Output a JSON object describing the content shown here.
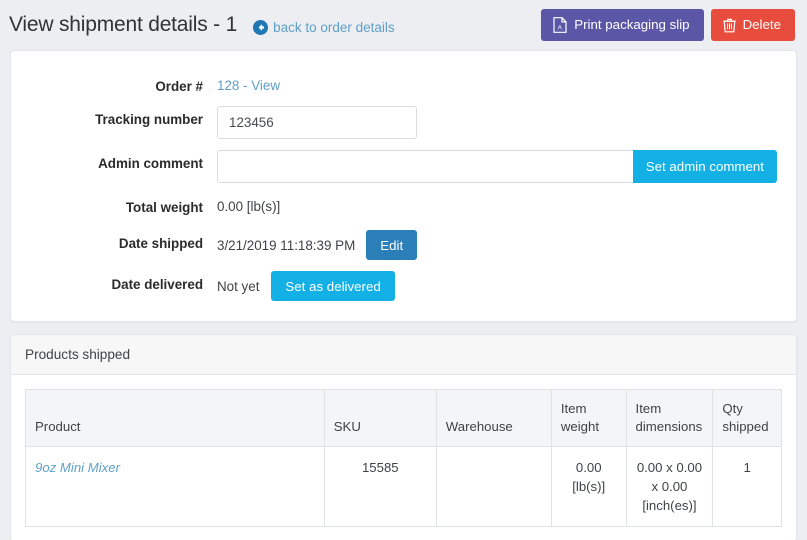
{
  "header": {
    "title": "View shipment details - 1",
    "back_link": "back to order details",
    "back_icon": "arrow-circle-left-icon",
    "print_button": "Print packaging slip",
    "print_icon": "pdf-file-icon",
    "delete_button": "Delete",
    "delete_icon": "trash-icon",
    "colors": {
      "print_bg": "#5b57a6",
      "delete_bg": "#e74c3c",
      "link": "#5f9fc6"
    }
  },
  "form": {
    "order_label": "Order #",
    "order_value": "128 - View",
    "tracking_label": "Tracking number",
    "tracking_value": "123456",
    "tracking_placeholder": "",
    "admin_comment_label": "Admin comment",
    "admin_comment_value": "",
    "admin_comment_placeholder": "",
    "set_admin_comment_button": "Set admin comment",
    "total_weight_label": "Total weight",
    "total_weight_value": "0.00 [lb(s)]",
    "date_shipped_label": "Date shipped",
    "date_shipped_value": "3/21/2019 11:18:39 PM",
    "edit_button": "Edit",
    "date_delivered_label": "Date delivered",
    "date_delivered_value": "Not yet",
    "set_delivered_button": "Set as delivered",
    "colors": {
      "primary_cyan": "#13b0e6",
      "edit_blue": "#2b7fb8"
    }
  },
  "products_panel": {
    "title": "Products shipped",
    "columns": [
      "Product",
      "SKU",
      "Warehouse",
      "Item weight",
      "Item dimensions",
      "Qty shipped"
    ],
    "rows": [
      {
        "product": "9oz Mini Mixer",
        "sku": "15585",
        "warehouse": "",
        "item_weight": "0.00 [lb(s)]",
        "item_dimensions": "0.00 x 0.00 x 0.00 [inch(es)]",
        "qty_shipped": "1"
      }
    ]
  }
}
